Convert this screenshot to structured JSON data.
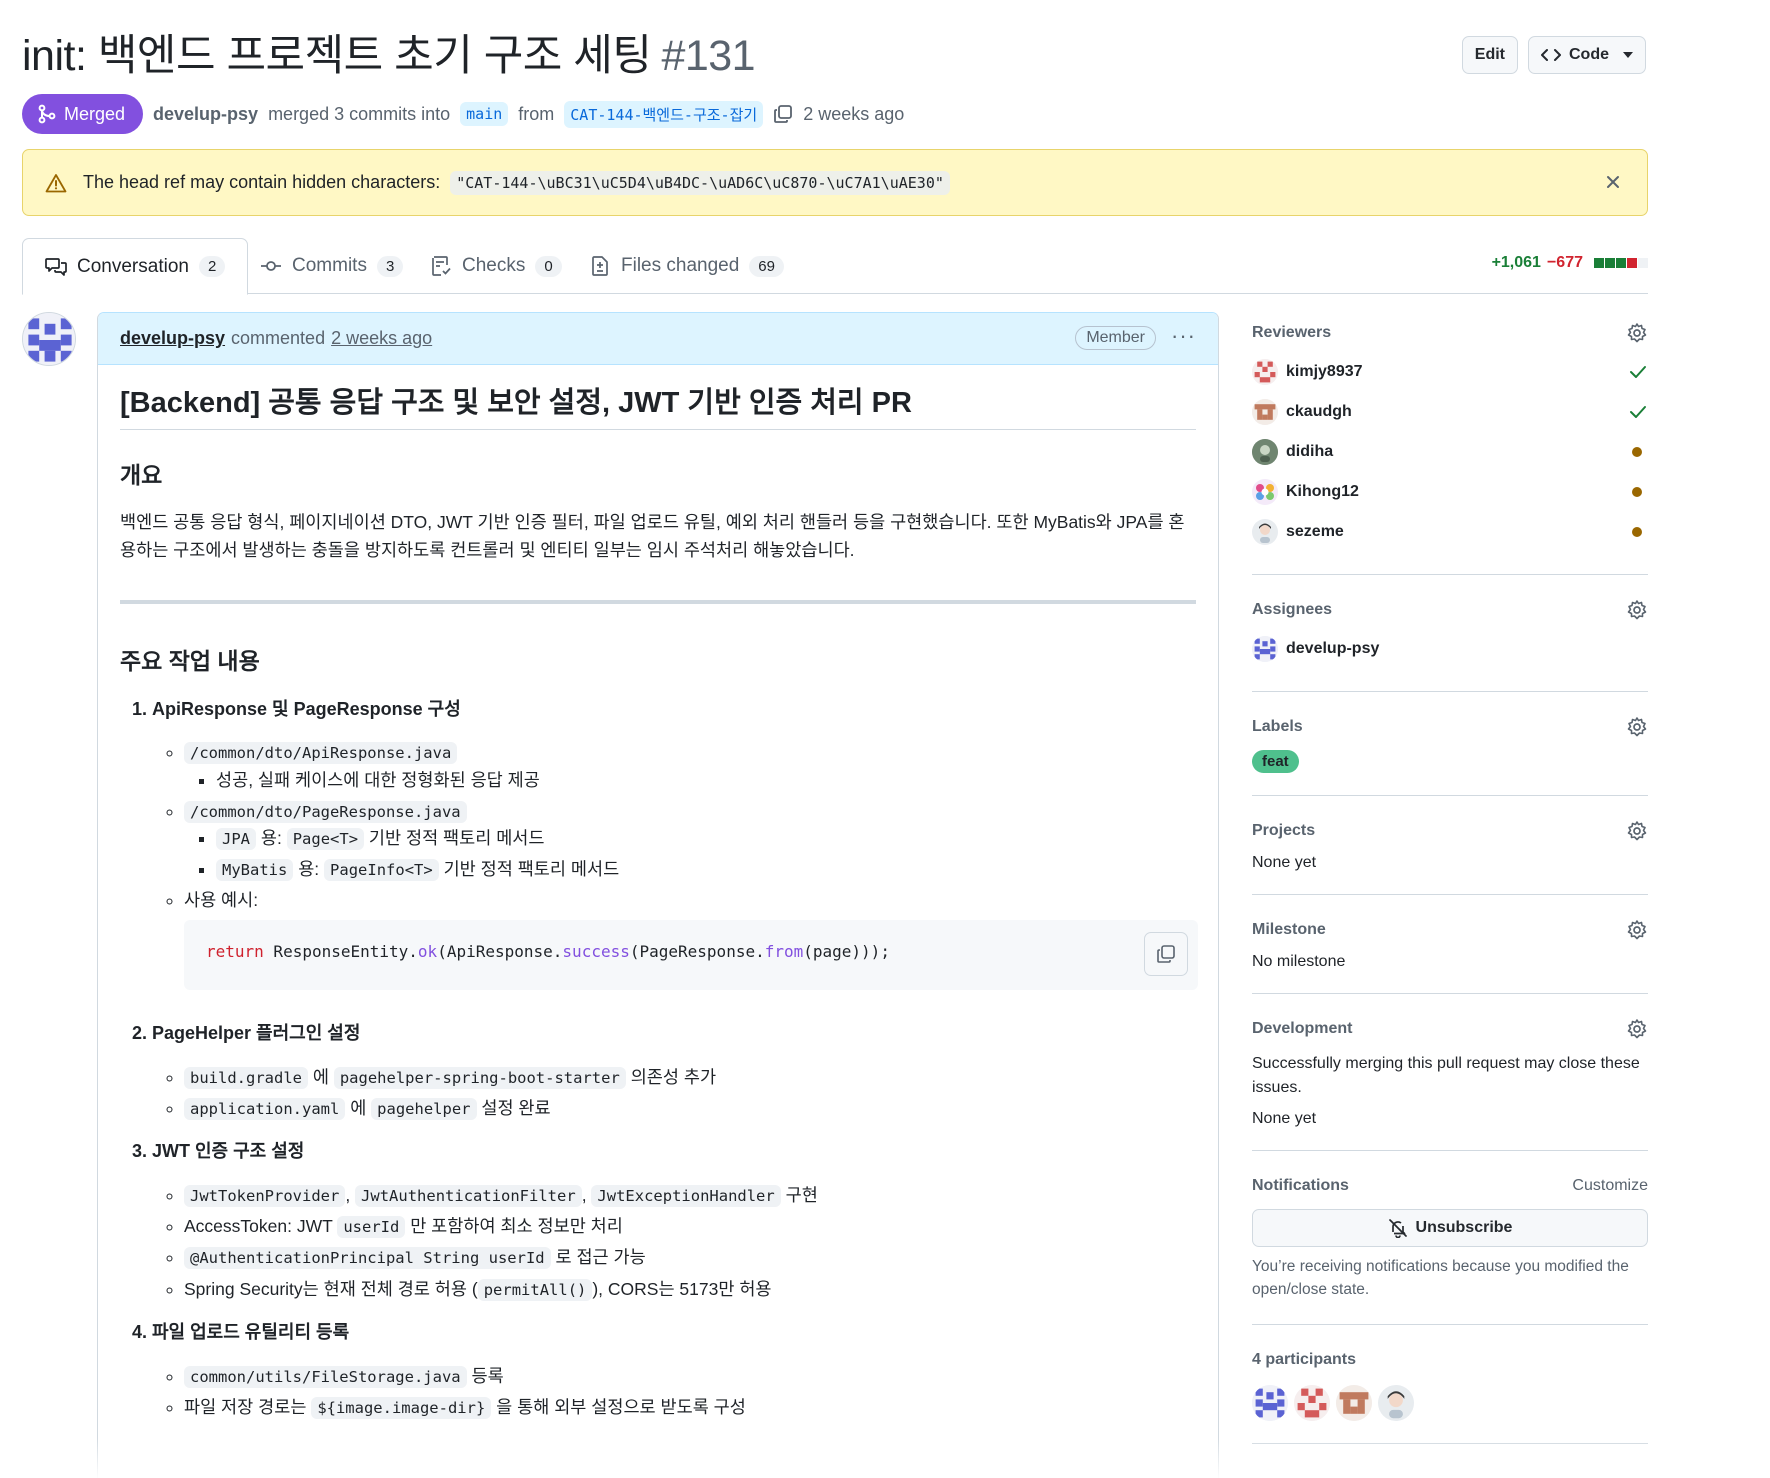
{
  "pr": {
    "title": "init: 백엔드 프로젝트 초기 구조 세팅",
    "number": "#131",
    "state": "Merged",
    "author": "develup-psy",
    "merged_text": "merged 3 commits into",
    "base_branch": "main",
    "from_text": "from",
    "head_branch": "CAT-144-백엔드-구조-잡기",
    "time": "2 weeks ago"
  },
  "header": {
    "edit_label": "Edit",
    "code_label": "Code"
  },
  "flash": {
    "text": "The head ref may contain hidden characters:",
    "code": "\"CAT-144-\\uBC31\\uC5D4\\uB4DC-\\uAD6C\\uC870-\\uC7A1\\uAE30\""
  },
  "tabs": [
    {
      "label": "Conversation",
      "count": "2",
      "icon": "comment-discussion-icon"
    },
    {
      "label": "Commits",
      "count": "3",
      "icon": "git-commit-icon"
    },
    {
      "label": "Checks",
      "count": "0",
      "icon": "checklist-icon"
    },
    {
      "label": "Files changed",
      "count": "69",
      "icon": "file-diff-icon"
    }
  ],
  "diffstat": {
    "additions": "+1,061",
    "deletions": "−677",
    "bars": [
      "green",
      "green",
      "green",
      "red",
      "gray"
    ]
  },
  "comment": {
    "author": "develup-psy",
    "action": "commented",
    "time": "2 weeks ago",
    "badge": "Member",
    "heading": "[Backend] 공통 응답 구조 및 보안 설정, JWT 기반 인증 처리 PR",
    "overview_heading": "개요",
    "overview_text": "백엔드 공통 응답 형식, 페이지네이션 DTO, JWT 기반 인증 필터, 파일 업로드 유틸, 예외 처리 핸들러 등을 구현했습니다. 또한 MyBatis와 JPA를 혼용하는 구조에서 발생하는 충돌을 방지하도록 컨트롤러 및 엔티티 일부는 임시 주석처리 해놓았습니다.",
    "work_heading": "주요 작업 내용",
    "items": {
      "i1_title": "ApiResponse 및 PageResponse 구성",
      "i1_a_code": "/common/dto/ApiResponse.java",
      "i1_a_sub": "성공, 실패 케이스에 대한 정형화된 응답 제공",
      "i1_b_code": "/common/dto/PageResponse.java",
      "i1_b_sub1_code": "JPA",
      "i1_b_sub1_text1": "용:",
      "i1_b_sub1_code2": "Page<T>",
      "i1_b_sub1_text2": "기반 정적 팩토리 메서드",
      "i1_b_sub2_code": "MyBatis",
      "i1_b_sub2_text1": "용:",
      "i1_b_sub2_code2": "PageInfo<T>",
      "i1_b_sub2_text2": "기반 정적 팩토리 메서드",
      "i1_c_text": "사용 예시:",
      "code_return": "return",
      "code_p1": " ResponseEntity.",
      "code_ok": "ok",
      "code_p2": "(ApiResponse.",
      "code_success": "success",
      "code_p3": "(PageResponse.",
      "code_from": "from",
      "code_p4": "(page)));",
      "i2_title": "PageHelper 플러그인 설정",
      "i2_a_code": "build.gradle",
      "i2_a_text1": "에",
      "i2_a_code2": "pagehelper-spring-boot-starter",
      "i2_a_text2": "의존성 추가",
      "i2_b_code": "application.yaml",
      "i2_b_text1": "에",
      "i2_b_code2": "pagehelper",
      "i2_b_text2": "설정 완료",
      "i3_title": "JWT 인증 구조 설정",
      "i3_a_code1": "JwtTokenProvider",
      "i3_a_code2": "JwtAuthenticationFilter",
      "i3_a_code3": "JwtExceptionHandler",
      "i3_a_text": "구현",
      "i3_b_text1": "AccessToken: JWT",
      "i3_b_code": "userId",
      "i3_b_text2": "만 포함하여 최소 정보만 처리",
      "i3_c_code": "@AuthenticationPrincipal String userId",
      "i3_c_text": "로 접근 가능",
      "i3_d_text1": "Spring Security는 현재 전체 경로 허용 (",
      "i3_d_code": "permitAll()",
      "i3_d_text2": "), CORS는 5173만 허용",
      "i4_title": "파일 업로드 유틸리티 등록",
      "i4_a_code": "common/utils/FileStorage.java",
      "i4_a_text": "등록",
      "i4_b_text1": "파일 저장 경로는",
      "i4_b_code": "${image.image-dir}",
      "i4_b_text2": "을 통해 외부 설정으로 받도록 구성"
    }
  },
  "sidebar": {
    "reviewers_heading": "Reviewers",
    "reviewers": [
      {
        "name": "kimjy8937",
        "status": "approved"
      },
      {
        "name": "ckaudgh",
        "status": "approved"
      },
      {
        "name": "didiha",
        "status": "pending"
      },
      {
        "name": "Kihong12",
        "status": "pending"
      },
      {
        "name": "sezeme",
        "status": "pending"
      }
    ],
    "assignees_heading": "Assignees",
    "assignee": "develup-psy",
    "labels_heading": "Labels",
    "label": "feat",
    "label_color": "#4fc08d",
    "projects_heading": "Projects",
    "projects_value": "None yet",
    "milestone_heading": "Milestone",
    "milestone_value": "No milestone",
    "development_heading": "Development",
    "development_text": "Successfully merging this pull request may close these issues.",
    "development_value": "None yet",
    "notifications_heading": "Notifications",
    "customize": "Customize",
    "unsubscribe": "Unsubscribe",
    "notifications_note": "You’re receiving notifications because you modified the open/close state.",
    "participants_heading": "4 participants"
  },
  "colors": {
    "merged": "#8250df",
    "link": "#0969da",
    "additions": "#1a7f37",
    "deletions": "#d1242f",
    "pending": "#9a6700"
  }
}
